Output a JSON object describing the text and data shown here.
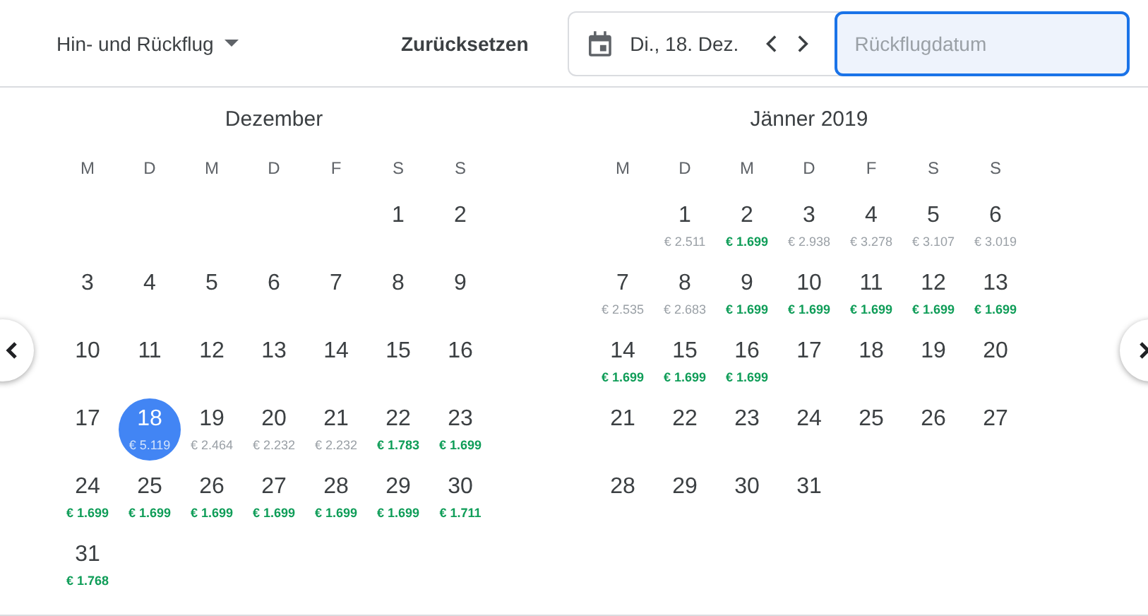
{
  "trip_type": {
    "label": "Hin- und Rückflug"
  },
  "reset_button": "Zurücksetzen",
  "departure": {
    "value": "Di., 18. Dez."
  },
  "return": {
    "placeholder": "Rückflugdatum"
  },
  "months": [
    {
      "title": "Dezember",
      "weekdays": [
        "M",
        "D",
        "M",
        "D",
        "F",
        "S",
        "S"
      ],
      "weeks": [
        [
          {
            "day": "1",
            "selected": false
          },
          {
            "day": "2",
            "selected": false
          }
        ],
        [
          {
            "day": "3",
            "selected": false
          },
          {
            "day": "4",
            "selected": false
          },
          {
            "day": "5",
            "selected": false
          },
          {
            "day": "6",
            "selected": false
          },
          {
            "day": "7",
            "selected": false
          },
          {
            "day": "8",
            "selected": false
          },
          {
            "day": "9",
            "selected": false
          }
        ],
        [
          {
            "day": "10",
            "selected": false
          },
          {
            "day": "11",
            "selected": false
          },
          {
            "day": "12",
            "selected": false
          },
          {
            "day": "13",
            "selected": false
          },
          {
            "day": "14",
            "selected": false
          },
          {
            "day": "15",
            "selected": false
          },
          {
            "day": "16",
            "selected": false
          }
        ],
        [
          {
            "day": "17",
            "selected": false
          },
          {
            "day": "18",
            "selected": true,
            "price": "€ 5.119"
          },
          {
            "day": "19",
            "selected": false,
            "price": "€ 2.464",
            "low": false
          },
          {
            "day": "20",
            "selected": false,
            "price": "€ 2.232",
            "low": false
          },
          {
            "day": "21",
            "selected": false,
            "price": "€ 2.232",
            "low": false
          },
          {
            "day": "22",
            "selected": false,
            "price": "€ 1.783",
            "low": true
          },
          {
            "day": "23",
            "selected": false,
            "price": "€ 1.699",
            "low": true
          }
        ],
        [
          {
            "day": "24",
            "selected": false,
            "price": "€ 1.699",
            "low": true
          },
          {
            "day": "25",
            "selected": false,
            "price": "€ 1.699",
            "low": true
          },
          {
            "day": "26",
            "selected": false,
            "price": "€ 1.699",
            "low": true
          },
          {
            "day": "27",
            "selected": false,
            "price": "€ 1.699",
            "low": true
          },
          {
            "day": "28",
            "selected": false,
            "price": "€ 1.699",
            "low": true
          },
          {
            "day": "29",
            "selected": false,
            "price": "€ 1.699",
            "low": true
          },
          {
            "day": "30",
            "selected": false,
            "price": "€ 1.711",
            "low": true
          }
        ],
        [
          {
            "day": "31",
            "selected": false,
            "price": "€ 1.768",
            "low": true
          }
        ]
      ]
    },
    {
      "title": "Jänner 2019",
      "weekdays": [
        "M",
        "D",
        "M",
        "D",
        "F",
        "S",
        "S"
      ],
      "weeks": [
        [
          {
            "day": "1",
            "selected": false,
            "price": "€ 2.511",
            "low": false
          },
          {
            "day": "2",
            "selected": false,
            "price": "€ 1.699",
            "low": true
          },
          {
            "day": "3",
            "selected": false,
            "price": "€ 2.938",
            "low": false
          },
          {
            "day": "4",
            "selected": false,
            "price": "€ 3.278",
            "low": false
          },
          {
            "day": "5",
            "selected": false,
            "price": "€ 3.107",
            "low": false
          },
          {
            "day": "6",
            "selected": false,
            "price": "€ 3.019",
            "low": false
          }
        ],
        [
          {
            "day": "7",
            "selected": false,
            "price": "€ 2.535",
            "low": false
          },
          {
            "day": "8",
            "selected": false,
            "price": "€ 2.683",
            "low": false
          },
          {
            "day": "9",
            "selected": false,
            "price": "€ 1.699",
            "low": true
          },
          {
            "day": "10",
            "selected": false,
            "price": "€ 1.699",
            "low": true
          },
          {
            "day": "11",
            "selected": false,
            "price": "€ 1.699",
            "low": true
          },
          {
            "day": "12",
            "selected": false,
            "price": "€ 1.699",
            "low": true
          },
          {
            "day": "13",
            "selected": false,
            "price": "€ 1.699",
            "low": true
          }
        ],
        [
          {
            "day": "14",
            "selected": false,
            "price": "€ 1.699",
            "low": true
          },
          {
            "day": "15",
            "selected": false,
            "price": "€ 1.699",
            "low": true
          },
          {
            "day": "16",
            "selected": false,
            "price": "€ 1.699",
            "low": true
          },
          {
            "day": "17",
            "selected": false
          },
          {
            "day": "18",
            "selected": false
          },
          {
            "day": "19",
            "selected": false
          },
          {
            "day": "20",
            "selected": false
          }
        ],
        [
          {
            "day": "21",
            "selected": false
          },
          {
            "day": "22",
            "selected": false
          },
          {
            "day": "23",
            "selected": false
          },
          {
            "day": "24",
            "selected": false
          },
          {
            "day": "25",
            "selected": false
          },
          {
            "day": "26",
            "selected": false
          },
          {
            "day": "27",
            "selected": false
          }
        ],
        [
          {
            "day": "28",
            "selected": false
          },
          {
            "day": "29",
            "selected": false
          },
          {
            "day": "30",
            "selected": false
          },
          {
            "day": "31",
            "selected": false
          }
        ]
      ]
    }
  ]
}
